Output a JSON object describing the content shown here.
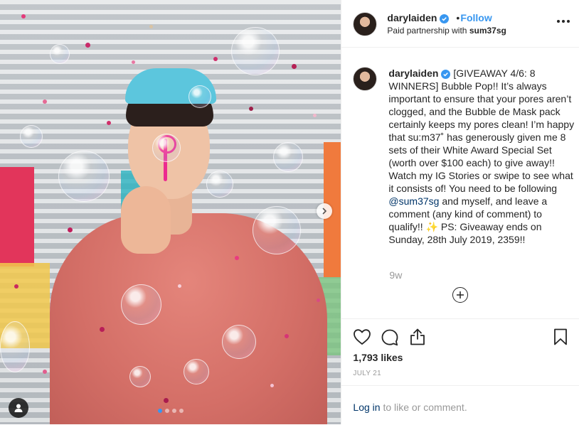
{
  "header": {
    "username": "darylaiden",
    "follow_label": "Follow",
    "separator": "•",
    "subtitle_prefix": "Paid partnership with",
    "partner": "sum37sg"
  },
  "caption": {
    "username": "darylaiden",
    "text_part1": "[GIVEAWAY 4/6: 8 WINNERS] Bubble Pop!! It’s always important to ensure that your pores aren’t clogged, and the Bubble de Mask pack certainly keeps my pores clean! I’m happy that su:m37˚ has generously given me 8 sets of their White Award Special Set (worth over $100 each) to give away!! Watch my IG Stories or swipe to see what it consists of! You need to be following ",
    "mention": "@sum37sg",
    "text_part2": " and myself, and leave a comment (any kind of comment) to qualify!! ✨ PS: Giveaway ends on Sunday, 28th July 2019, 2359!!",
    "age": "9w"
  },
  "stats": {
    "likes": "1,793 likes",
    "date": "JULY 21"
  },
  "login": {
    "link": "Log in",
    "rest": " to like or comment."
  },
  "carousel": {
    "slides": 4,
    "active": 1
  },
  "colors": {
    "accent": "#3897f0",
    "text": "#262626",
    "muted": "#999999",
    "link": "#003569"
  },
  "icons": [
    "verified-icon",
    "more-options-icon",
    "heart-icon",
    "comment-icon",
    "share-icon",
    "bookmark-icon",
    "plus-circle-icon",
    "chevron-right-icon",
    "user-tag-icon"
  ]
}
